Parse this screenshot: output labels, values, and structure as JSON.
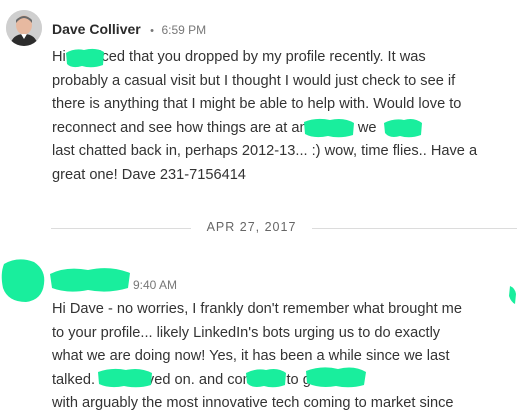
{
  "colors": {
    "redaction": "#19ee9d",
    "separator": "#dcdcdc",
    "meta_text": "#777777"
  },
  "messages": [
    {
      "sender": "Dave Colliver",
      "separator_dot": "•",
      "time": "6:59 PM",
      "avatar_icon": "user-avatar-photo",
      "lines": [
        "Hi        I noticed that you dropped by my profile recently. It was",
        "probably a casual visit but I thought I would just check to see if",
        "there is anything that I might be able to help with. Would love to",
        "reconnect and see how things are at             and          since we",
        "last chatted back in, perhaps 2012-13... :) wow, time flies.. Have a",
        "great one! Dave 231-7156414"
      ]
    },
    {
      "sender": "",
      "separator_dot": "",
      "time": "9:40 AM",
      "avatar_icon": "redacted-avatar",
      "lines": [
        "Hi Dave - no worries, I frankly don't remember what brought me",
        "to your profile... likely LinkedIn's bots urging us to do exactly",
        "what we are doing now! Yes, it has been a while since we last",
        "talked.             has moved on.          and              continue to grow",
        "with arguably the most innovative tech coming to market since"
      ]
    }
  ],
  "date_separator": "APR 27, 2017"
}
